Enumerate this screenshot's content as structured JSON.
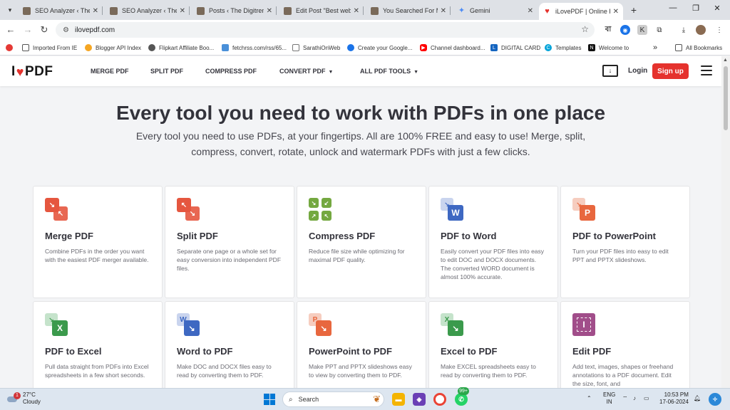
{
  "browser": {
    "tabs": [
      {
        "title": "SEO Analyzer ‹ The D",
        "icon": "site-favicon"
      },
      {
        "title": "SEO Analyzer ‹ The D",
        "icon": "site-favicon"
      },
      {
        "title": "Posts ‹ The Digitrend",
        "icon": "site-favicon"
      },
      {
        "title": "Edit Post \"Best websi",
        "icon": "site-favicon"
      },
      {
        "title": "You Searched For Mi",
        "icon": "site-favicon"
      },
      {
        "title": "Gemini",
        "icon": "gemini-icon"
      },
      {
        "title": "iLovePDF | Online PD",
        "icon": "ilovepdf-heart-icon",
        "active": true
      }
    ],
    "url": "ilovepdf.com",
    "bookmarks": [
      {
        "label": "Imported From IE",
        "icon": "folder-icon"
      },
      {
        "label": "Blogger API Index",
        "icon": "link-icon"
      },
      {
        "label": "Flipkart Affiliate Boo...",
        "icon": "globe-icon"
      },
      {
        "label": "fetchrss.com/rss/65...",
        "icon": "rss-icon"
      },
      {
        "label": "SarathiOnWeb",
        "icon": "page-icon"
      },
      {
        "label": "Create your Google...",
        "icon": "google-icon"
      },
      {
        "label": "Channel dashboard...",
        "icon": "youtube-icon"
      },
      {
        "label": "DIGITAL CARD",
        "icon": "letter-l-icon"
      },
      {
        "label": "Templates",
        "icon": "canva-icon"
      },
      {
        "label": "Welcome to",
        "icon": "notion-icon"
      }
    ],
    "all_bookmarks_label": "All Bookmarks",
    "more_bookmarks_label": "»",
    "ext_letter": "বা"
  },
  "site": {
    "logo_left": "I",
    "logo_right": "PDF",
    "nav": {
      "merge": "MERGE PDF",
      "split": "SPLIT PDF",
      "compress": "COMPRESS PDF",
      "convert": "CONVERT PDF",
      "all_tools": "ALL PDF TOOLS"
    },
    "login": "Login",
    "signup": "Sign up",
    "accent_color": "#e5322d"
  },
  "hero": {
    "title": "Every tool you need to work with PDFs in one place",
    "subtitle": "Every tool you need to use PDFs, at your fingertips. All are 100% FREE and easy to use! Merge, split, compress, convert, rotate, unlock and watermark PDFs with just a few clicks."
  },
  "tools": [
    {
      "name": "Merge PDF",
      "desc": "Combine PDFs in the order you want with the easiest PDF merger available.",
      "icon": "merge-icon",
      "color": "#e5563f"
    },
    {
      "name": "Split PDF",
      "desc": "Separate one page or a whole set for easy conversion into independent PDF files.",
      "icon": "split-icon",
      "color": "#e5563f"
    },
    {
      "name": "Compress PDF",
      "desc": "Reduce file size while optimizing for maximal PDF quality.",
      "icon": "compress-icon",
      "color": "#74a840"
    },
    {
      "name": "PDF to Word",
      "desc": "Easily convert your PDF files into easy to edit DOC and DOCX documents. The converted WORD document is almost 100% accurate.",
      "icon": "pdf-to-word-icon",
      "color": "#3e68c2"
    },
    {
      "name": "PDF to PowerPoint",
      "desc": "Turn your PDF files into easy to edit PPT and PPTX slideshows.",
      "icon": "pdf-to-powerpoint-icon",
      "color": "#e8673e"
    },
    {
      "name": "PDF to Excel",
      "desc": "Pull data straight from PDFs into Excel spreadsheets in a few short seconds.",
      "icon": "pdf-to-excel-icon",
      "color": "#3b9a4c"
    },
    {
      "name": "Word to PDF",
      "desc": "Make DOC and DOCX files easy to read by converting them to PDF.",
      "icon": "word-to-pdf-icon",
      "color": "#3e68c2"
    },
    {
      "name": "PowerPoint to PDF",
      "desc": "Make PPT and PPTX slideshows easy to view by converting them to PDF.",
      "icon": "powerpoint-to-pdf-icon",
      "color": "#e8673e"
    },
    {
      "name": "Excel to PDF",
      "desc": "Make EXCEL spreadsheets easy to read by converting them to PDF.",
      "icon": "excel-to-pdf-icon",
      "color": "#3b9a4c"
    },
    {
      "name": "Edit PDF",
      "desc": "Add text, images, shapes or freehand annotations to a PDF document. Edit the size, font, and",
      "icon": "edit-pdf-icon",
      "color": "#a14e8a"
    }
  ],
  "taskbar": {
    "temperature": "27°C",
    "weather": "Cloudy",
    "weather_badge": "1",
    "search_placeholder": "Search",
    "whatsapp_badge": "99+",
    "lang_primary": "ENG",
    "lang_secondary": "IN",
    "time": "10:53 PM",
    "date": "17-06-2024"
  }
}
